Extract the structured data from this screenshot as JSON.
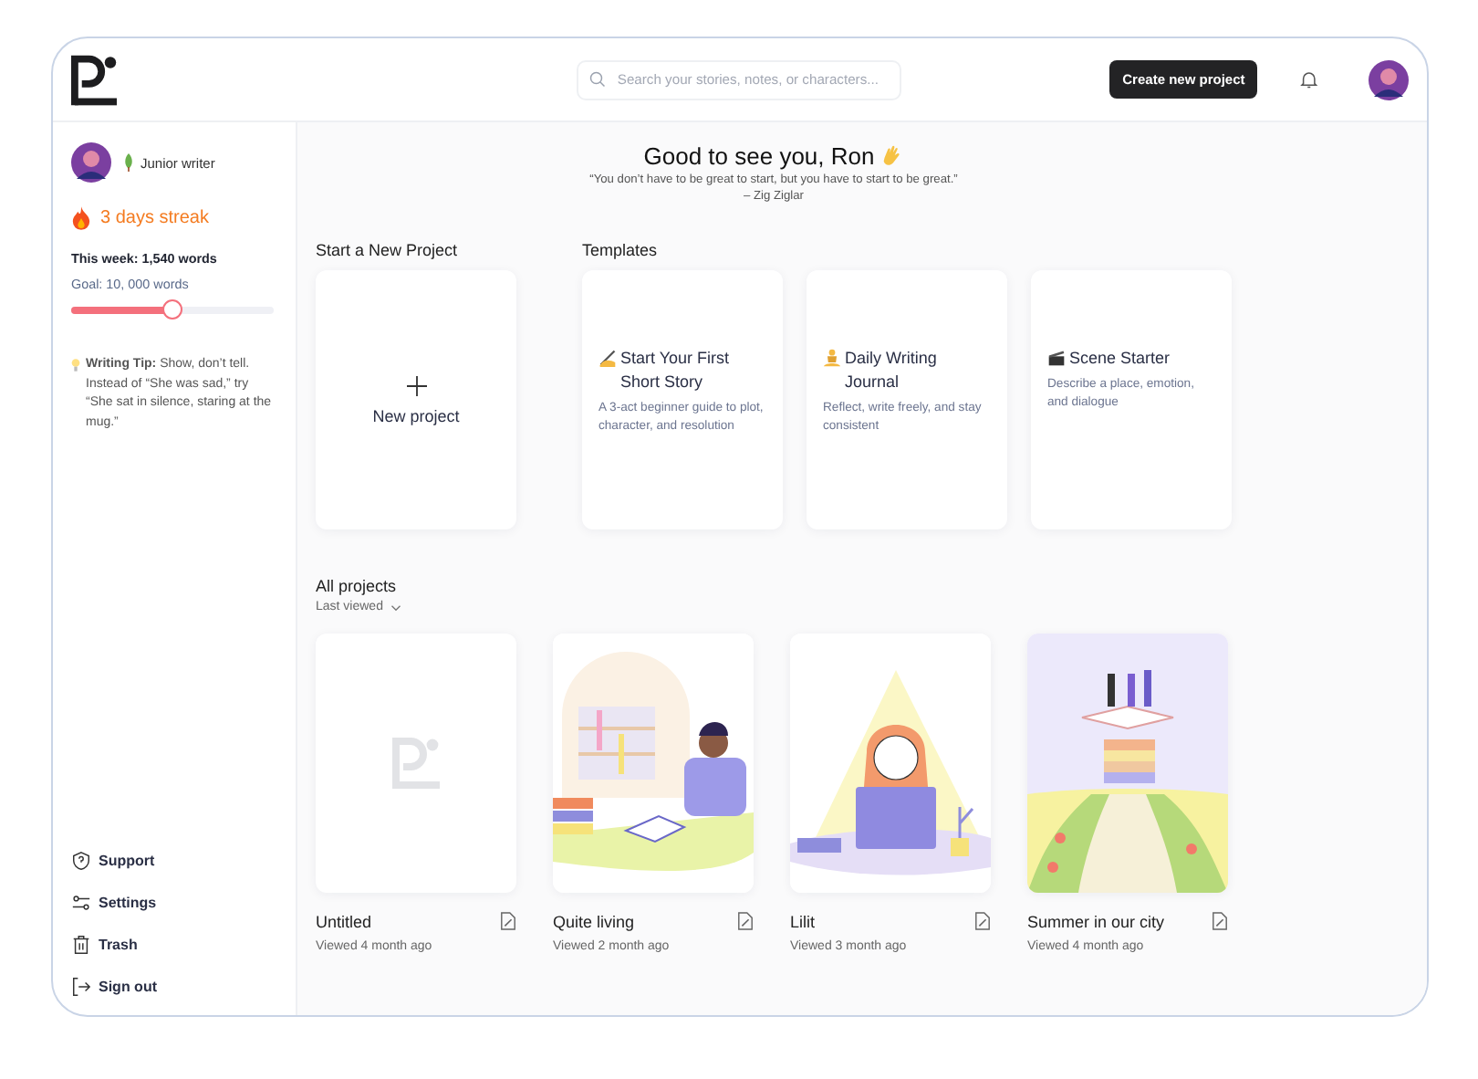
{
  "header": {
    "search": {
      "placeholder": "Search your stories, notes, or characters..."
    },
    "create_button": "Create new project"
  },
  "sidebar": {
    "rank": "Junior writer",
    "streak": "3 days streak",
    "week": "This week: 1,540 words",
    "goal": "Goal: 10, 000 words",
    "progress": {
      "level": 0.5
    },
    "tip": "**Writing Tip:** Show, don’t tell. Instead of “She was sad,” try “She sat in silence, staring at the mug.”",
    "nav": [
      {
        "kind": "support",
        "label": "Support"
      },
      {
        "kind": "settings",
        "label": "Settings"
      },
      {
        "kind": "trash",
        "label": "Trash"
      },
      {
        "kind": "signout",
        "label": "Sign out"
      }
    ]
  },
  "greeting": {
    "title": "Good to see you, Ron",
    "quote": "“You don’t have to be great to start, but you have to start to be great.”",
    "author": "– Zig Ziglar"
  },
  "new_project": {
    "heading": "Start a New Project",
    "label": "New project"
  },
  "templates": {
    "heading": "Templates",
    "items": [
      {
        "kind": "pen",
        "title": "Start Your First Short Story",
        "description": "A 3-act beginner guide to plot, character, and resolution"
      },
      {
        "kind": "meditation",
        "title": "Daily Writing Journal",
        "description": "Reflect, write freely, and stay consistent"
      },
      {
        "kind": "clapper",
        "title": "Scene Starter",
        "description": "Describe a place, emotion, and dialogue"
      }
    ]
  },
  "projects": {
    "heading": "All projects",
    "sort": "Last viewed",
    "items": [
      {
        "kind": "blank",
        "title": "Untitled",
        "viewed": "Viewed 4 month ago"
      },
      {
        "kind": "desk",
        "title": "Quite living",
        "viewed": "Viewed 2 month ago"
      },
      {
        "kind": "reading",
        "title": "Lilit",
        "viewed": "Viewed 3 month ago"
      },
      {
        "kind": "books",
        "title": "Summer in our city",
        "viewed": "Viewed 4 month ago"
      }
    ]
  }
}
